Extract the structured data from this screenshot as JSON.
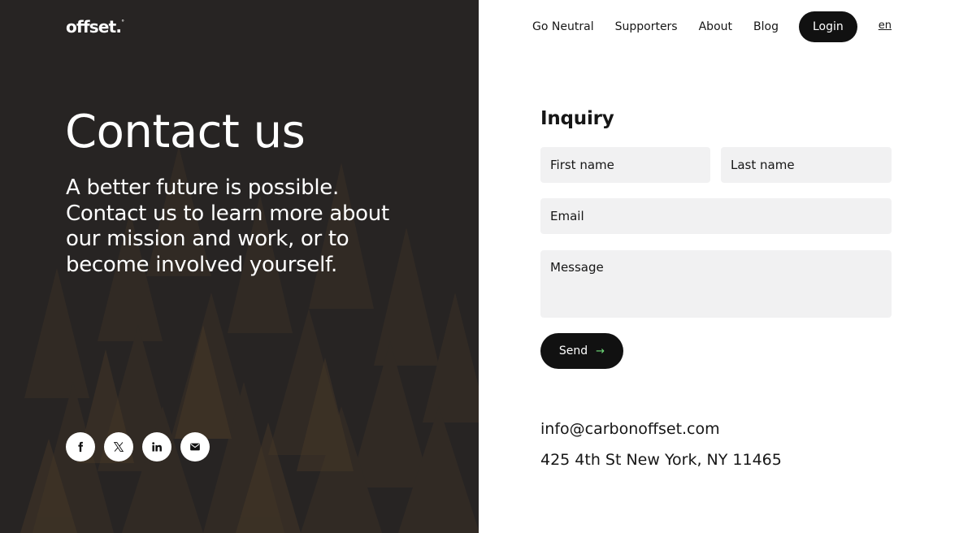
{
  "brand": {
    "logo_text": "offset.",
    "logo_mark": "°"
  },
  "nav": {
    "links": [
      "Go Neutral",
      "Supporters",
      "About",
      "Blog"
    ],
    "login_label": "Login",
    "language": "en"
  },
  "hero": {
    "title": "Contact us",
    "subtitle": "A better future is possible. Contact us to learn more about our mission and work, or to become involved yourself."
  },
  "socials": [
    {
      "name": "facebook-icon"
    },
    {
      "name": "x-icon"
    },
    {
      "name": "linkedin-icon"
    },
    {
      "name": "email-icon"
    }
  ],
  "form": {
    "title": "Inquiry",
    "first_name_placeholder": "First name",
    "last_name_placeholder": "Last name",
    "email_placeholder": "Email",
    "message_placeholder": "Message",
    "send_label": "Send",
    "send_arrow": "→"
  },
  "contact": {
    "email": "info@carbonoffset.com",
    "address": "425 4th St New York, NY 11465"
  },
  "colors": {
    "dark_panel": "#272423",
    "button": "#111111",
    "field_bg": "#f1f1f2",
    "arrow_accent": "#6fdc7a"
  }
}
